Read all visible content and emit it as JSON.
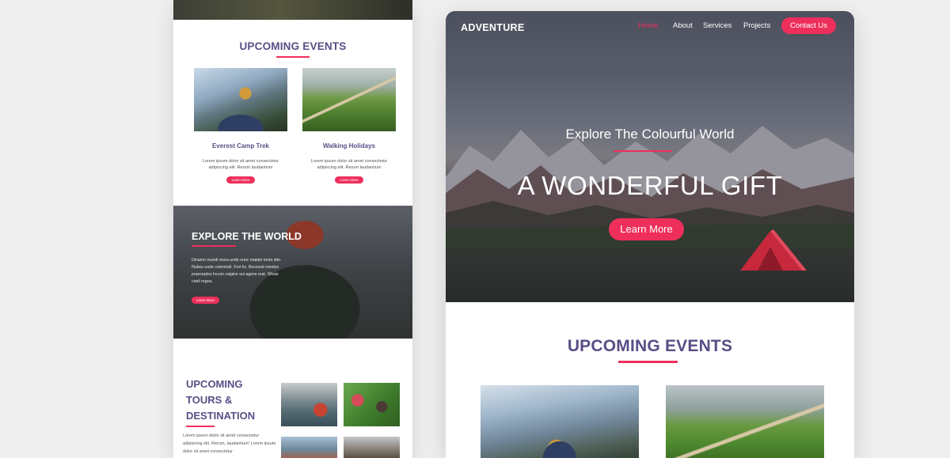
{
  "left_page": {
    "events": {
      "title": "UPCOMING EVENTS",
      "cards": [
        {
          "title": "Everest Camp Trek",
          "text": "Lorem ipsum dolor sit amet consectetur adipiscing elit. Rerum laudantium",
          "button": "Learn More"
        },
        {
          "title": "Walking Holidays",
          "text": "Lorem ipsum dolor sit amet consectetur adipiscing elit. Rerum laudantium",
          "button": "Learn More"
        }
      ]
    },
    "explore": {
      "title": "EXPLORE THE WORLD",
      "text": "Dinamo mundi mora unde nunc maiatn tonto sito. Nubes unde commodi. Fort lis. Recessit mentes praeceptes locum caigine sui agens erat. Silvas caeli regna.",
      "button": "Learn More"
    },
    "tours": {
      "title": "UPCOMING TOURS & DESTINATION",
      "text": "Lorem ipsum dolor sit amet consectetur adipiscing elit. Rerum, laudantium! Lorem ipsum dolor sit amet consectetur"
    }
  },
  "right_page": {
    "nav": {
      "logo": "ADVENTURE",
      "links": [
        "Home",
        "About",
        "Services",
        "Projects"
      ],
      "contact": "Contact Us"
    },
    "hero": {
      "subtitle": "Explore The Colourful World",
      "title": "A WONDERFUL GIFT",
      "button": "Learn More"
    },
    "events": {
      "title": "UPCOMING EVENTS"
    }
  },
  "colors": {
    "accent": "#ee2f5b",
    "heading": "#5a4d86",
    "background": "#efefef"
  }
}
